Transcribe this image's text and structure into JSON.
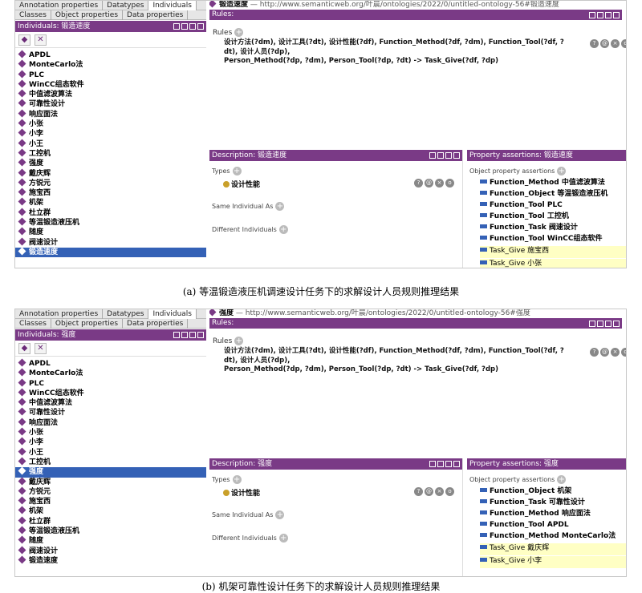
{
  "colors": {
    "accent": "#7a3a86",
    "selection": "#3461b6",
    "highlight": "#ffffc4",
    "type_dot": "#c9a02a"
  },
  "panels": [
    {
      "tabs_top": [
        "Annotation properties",
        "Datatypes",
        "Individuals"
      ],
      "tabs_bottom": [
        "Classes",
        "Object properties",
        "Data properties"
      ],
      "individuals_title": "Individuals: 锻造速度",
      "individuals": [
        "APDL",
        "MonteCarlo法",
        "PLC",
        "WinCC组态软件",
        "中值滤波算法",
        "可靠性设计",
        "响应面法",
        "小张",
        "小李",
        "小王",
        "工控机",
        "强度",
        "戴庆辉",
        "方锐元",
        "施宝西",
        "机架",
        "杜立群",
        "等温锻造液压机",
        "随度",
        "阀速设计",
        "锻造速度"
      ],
      "breadcrumb_name": "锻造速度",
      "breadcrumb_url": "— http://www.semanticweb.org/叶晨/ontologies/2022/0/untitled-ontology-56#锻造速度",
      "rules_title": "Rules:",
      "rules_label": "Rules",
      "rule_line1": "设计方法(?dm), 设计工具(?dt), 设计性能(?df), Function_Method(?df, ?dm), Function_Tool(?df, ?dt), 设计人员(?dp),",
      "rule_line2": "Person_Method(?dp, ?dm), Person_Tool(?dp, ?dt) -> Task_Give(?df, ?dp)",
      "description_title": "Description: 锻造速度",
      "types_label": "Types",
      "type_value": "设计性能",
      "same_label": "Same Individual As",
      "different_label": "Different Individuals",
      "property_title": "Property assertions: 锻造速度",
      "obj_prop_label": "Object property assertions",
      "assertions": [
        "Function_Method  中值滤波算法",
        "Function_Object  等温锻造液压机",
        "Function_Tool  PLC",
        "Function_Tool  工控机",
        "Function_Task  阀速设计",
        "Function_Tool  WinCC组态软件"
      ],
      "inferred": [
        "Task_Give  施宝西",
        "Task_Give  小张"
      ],
      "caption": "(a) 等温锻造液压机调速设计任务下的求解设计人员规则推理结果"
    },
    {
      "tabs_top": [
        "Annotation properties",
        "Datatypes",
        "Individuals"
      ],
      "tabs_bottom": [
        "Classes",
        "Object properties",
        "Data properties"
      ],
      "individuals_title": "Individuals: 强度",
      "individuals": [
        "APDL",
        "MonteCarlo法",
        "PLC",
        "WinCC组态软件",
        "中值滤波算法",
        "可靠性设计",
        "响应面法",
        "小张",
        "小李",
        "小王",
        "工控机",
        "强度",
        "戴庆辉",
        "方锐元",
        "施宝西",
        "机架",
        "杜立群",
        "等温锻造液压机",
        "随度",
        "阀速设计",
        "锻造速度"
      ],
      "breadcrumb_name": "强度",
      "breadcrumb_url": "— http://www.semanticweb.org/叶晨/ontologies/2022/0/untitled-ontology-56#强度",
      "rules_title": "Rules:",
      "rules_label": "Rules",
      "rule_line1": "设计方法(?dm), 设计工具(?dt), 设计性能(?df), Function_Method(?df, ?dm), Function_Tool(?df, ?dt), 设计人员(?dp),",
      "rule_line2": "Person_Method(?dp, ?dm), Person_Tool(?dp, ?dt) -> Task_Give(?df, ?dp)",
      "description_title": "Description: 强度",
      "types_label": "Types",
      "type_value": "设计性能",
      "same_label": "Same Individual As",
      "different_label": "Different Individuals",
      "property_title": "Property assertions: 强度",
      "obj_prop_label": "Object property assertions",
      "assertions": [
        "Function_Object  机架",
        "Function_Task  可靠性设计",
        "Function_Method  响应面法",
        "Function_Tool  APDL",
        "Function_Method  MonteCarlo法"
      ],
      "inferred": [
        "Task_Give  戴庆辉",
        "Task_Give  小李"
      ],
      "caption": "(b) 机架可靠性设计任务下的求解设计人员规则推理结果"
    }
  ]
}
